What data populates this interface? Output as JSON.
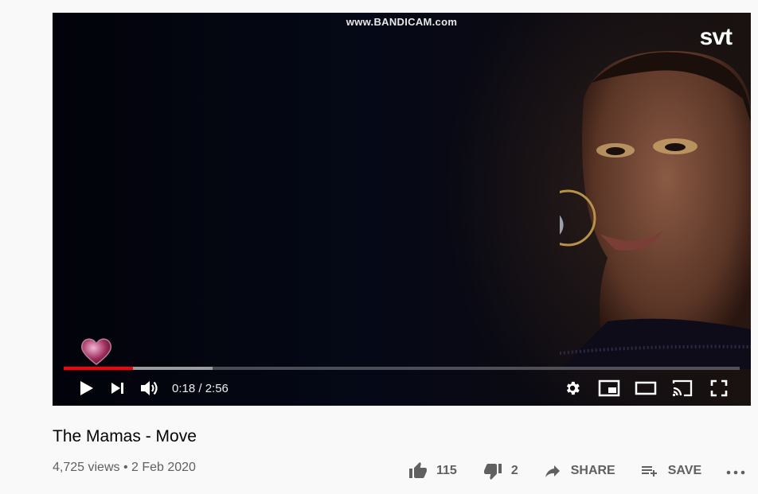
{
  "player": {
    "watermark": "www.BANDICAM.com",
    "channel_logo": "svt",
    "progress_fraction": 0.102,
    "buffered_fraction": 0.22,
    "time_display": "0:18 / 2:56",
    "icons": [
      "play-icon",
      "next-icon",
      "volume-icon",
      "settings-icon",
      "miniplayer-icon",
      "theater-icon",
      "cast-icon",
      "fullscreen-icon"
    ]
  },
  "video": {
    "title": "The Mamas - Move",
    "meta": "4,725 views • 2 Feb 2020"
  },
  "actions": {
    "like_count": "115",
    "dislike_count": "2",
    "share_label": "SHARE",
    "save_label": "SAVE"
  },
  "colors": {
    "progress": "#ff0000",
    "text_primary": "#030303",
    "text_secondary": "#606060"
  }
}
